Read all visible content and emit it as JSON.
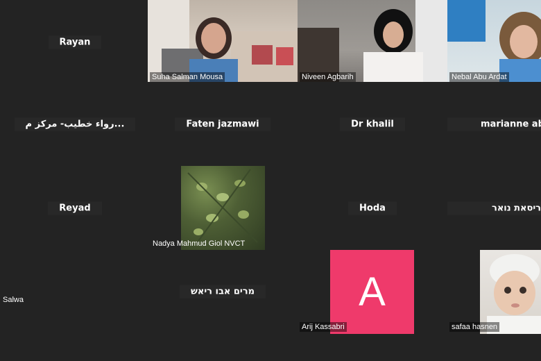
{
  "meeting": {
    "id_label": "video1151220879"
  },
  "participants": [
    {
      "name": "Rayan"
    },
    {
      "name": "Suha Salman Mousa"
    },
    {
      "name": "Niveen Agbarih"
    },
    {
      "name": "Nebal Abu Ardat"
    },
    {
      "name": "رواء خطيب- مركز م..."
    },
    {
      "name": "Faten jazmawi"
    },
    {
      "name": "Dr khalil"
    },
    {
      "name": "marianne abir"
    },
    {
      "name": "Reyad"
    },
    {
      "name": "Nadya Mahmud Giol NVCT"
    },
    {
      "name": "Hoda"
    },
    {
      "name": "ריסאת נואר"
    },
    {
      "name": "Salwa"
    },
    {
      "name": "מרים אבו ריאש"
    },
    {
      "name": "Arij Kassabri",
      "avatar_letter": "A"
    },
    {
      "name": "safaa hasnen"
    }
  ],
  "colors": {
    "avatar_bg": "#ef3a6b",
    "background": "#232323"
  }
}
